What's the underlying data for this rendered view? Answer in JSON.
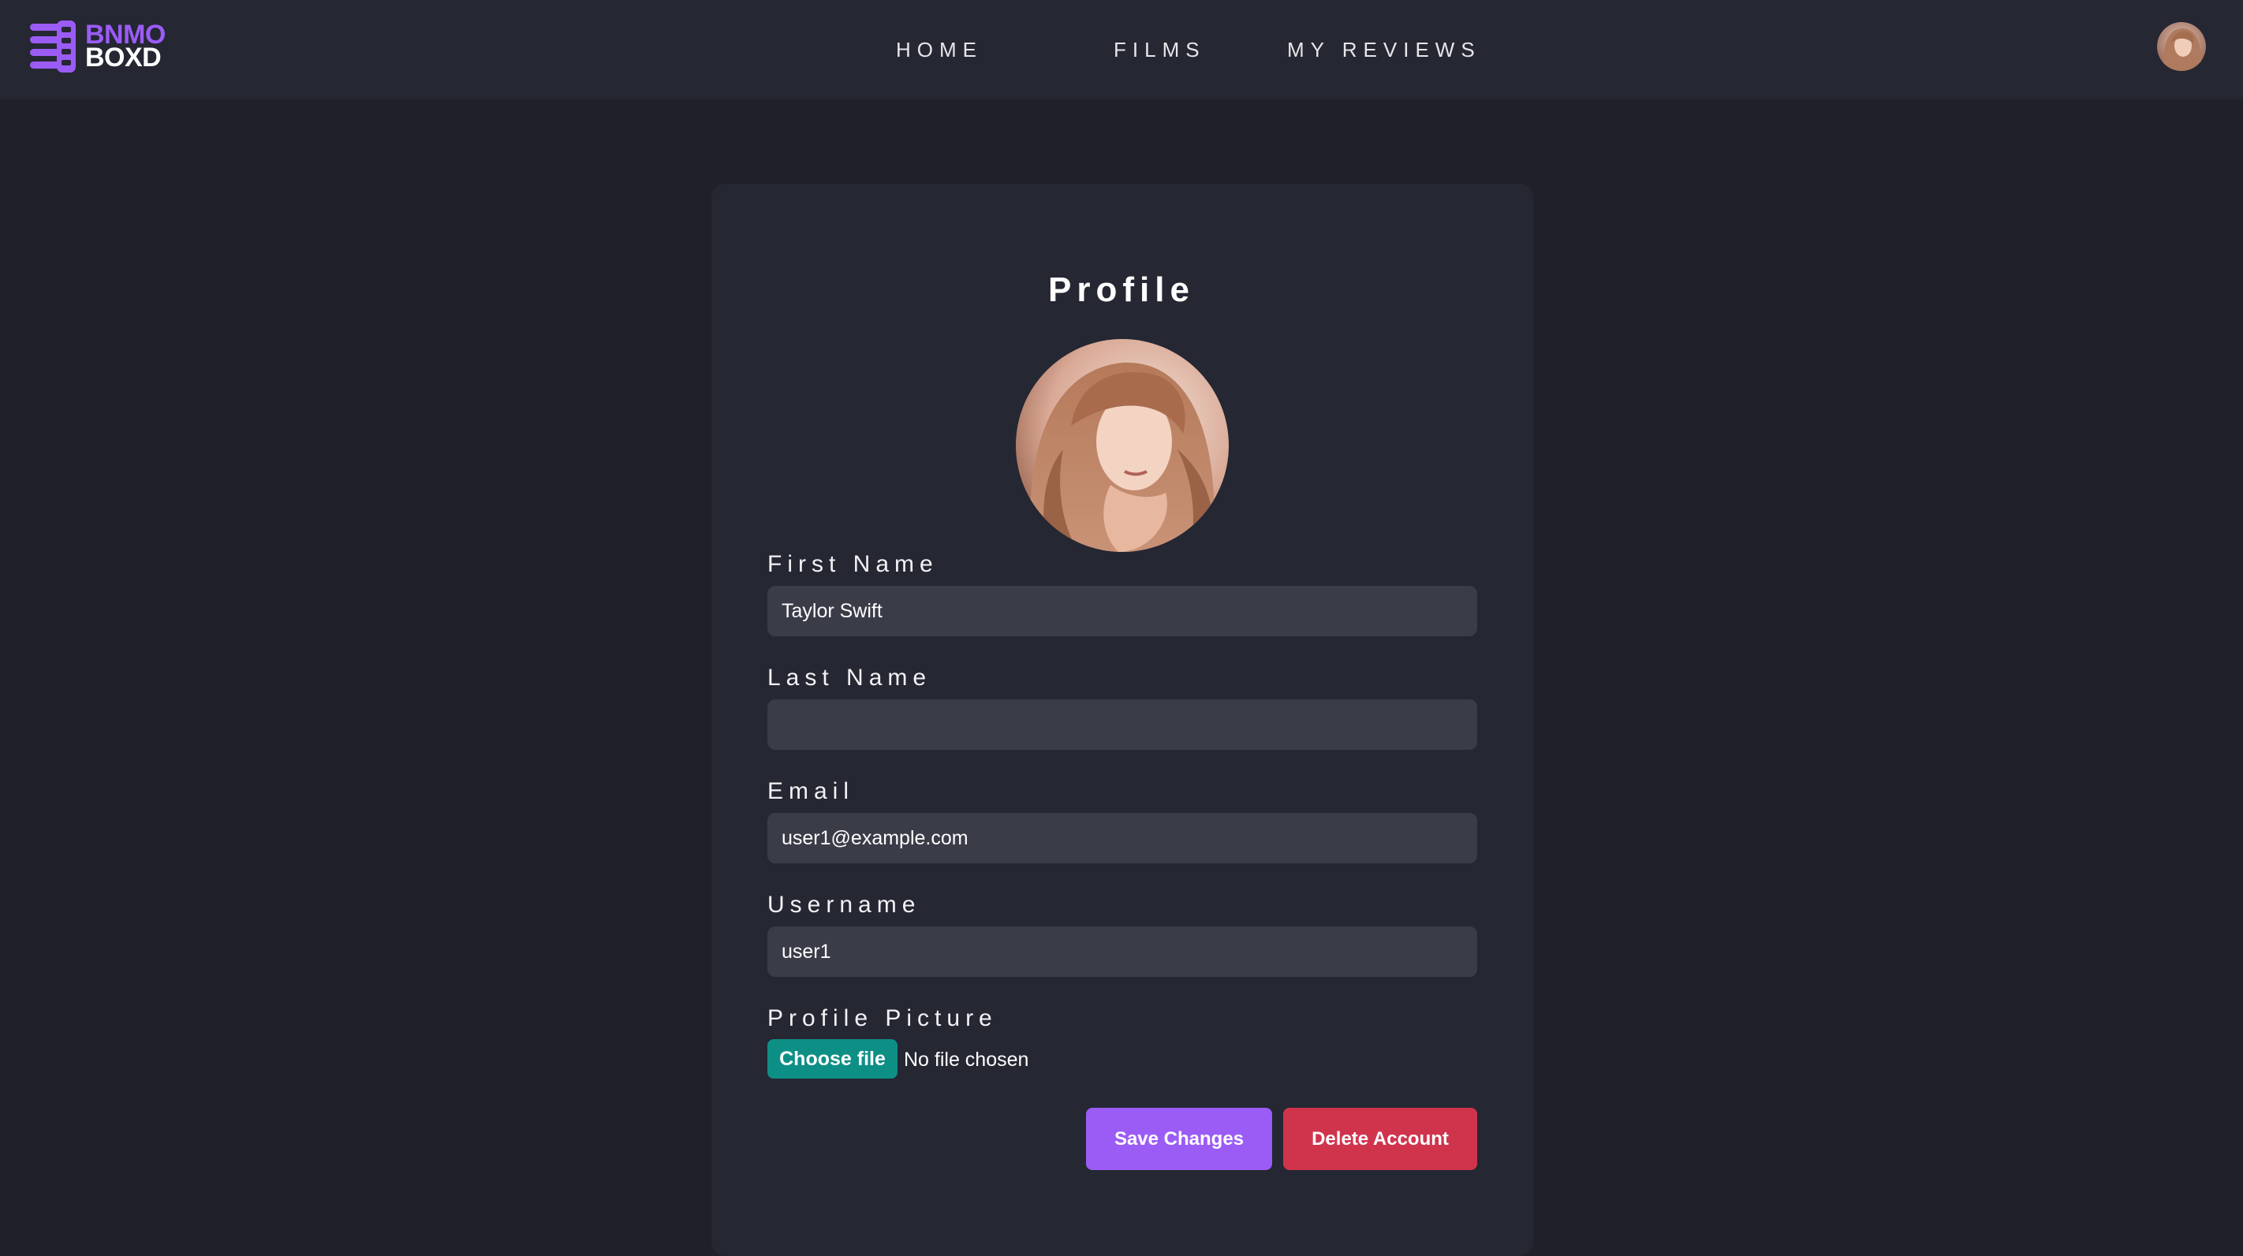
{
  "brand": {
    "line1": "BNMO",
    "line2": "BOXD",
    "colors": {
      "accent": "#9b5cf6",
      "text": "#ffffff"
    },
    "icon": "film-stack-icon"
  },
  "nav": {
    "links": [
      {
        "label": "HOME"
      },
      {
        "label": "FILMS"
      },
      {
        "label": "MY REVIEWS"
      }
    ],
    "avatar_icon": "user-avatar"
  },
  "profile": {
    "title": "Profile",
    "picture_icon": "profile-picture",
    "fields": {
      "first_name": {
        "label": "First Name",
        "value": "Taylor Swift"
      },
      "last_name": {
        "label": "Last Name",
        "value": ""
      },
      "email": {
        "label": "Email",
        "value": "user1@example.com"
      },
      "username": {
        "label": "Username",
        "value": "user1"
      },
      "picture": {
        "label": "Profile Picture",
        "button": "Choose file",
        "status": "No file chosen"
      }
    },
    "actions": {
      "save": "Save Changes",
      "delete": "Delete Account"
    }
  },
  "colors": {
    "background": "#1f2029",
    "surface": "#252733",
    "input": "#3a3c48",
    "primary": "#9b5cf6",
    "danger": "#d0344d",
    "file_button": "#0e8f86"
  }
}
